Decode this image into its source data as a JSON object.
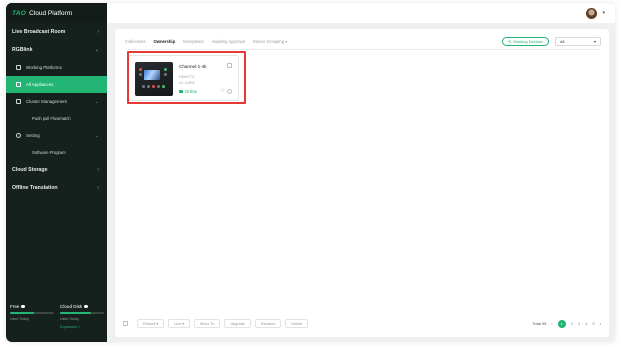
{
  "app": {
    "logo_mark": "TAO",
    "title": "Cloud Platform"
  },
  "sidebar": {
    "items": [
      {
        "label": "Live Broadcast Room"
      },
      {
        "label": "RGBlink"
      }
    ],
    "sub_items": [
      {
        "label": "Working Platforms"
      },
      {
        "label": "All Appliances"
      },
      {
        "label": "Cluster Management"
      },
      {
        "label": "Push pull Flowmatch"
      },
      {
        "label": "Setting"
      },
      {
        "label": "Software Program"
      }
    ],
    "bottom_items": [
      {
        "label": "Cloud Storage"
      },
      {
        "label": "Offline Translation"
      }
    ],
    "storage": {
      "left": {
        "title": "Free",
        "sub": "Used Today",
        "fill": 0.55
      },
      "right": {
        "title": "Cloud Disk",
        "sub": "Used Today",
        "fill": 0.7,
        "link": "Expansion >"
      }
    }
  },
  "header": {
    "avatar_caret": "▾"
  },
  "tabs": [
    "Collections",
    "Ownership",
    "Exceptions",
    "Awaiting Approval",
    "Device Grouping"
  ],
  "active_tab": "Ownership",
  "filter": {
    "button_label": "Working Devices",
    "select_value": "All"
  },
  "device": {
    "name": "Channel-1-4k",
    "line1": "HDMI TV",
    "line2": "V1.3.6R2",
    "status": "Online"
  },
  "footer": {
    "buttons": [
      "Reboot",
      "Live",
      "Move To",
      "Upgrade",
      "Rename",
      "Delete"
    ],
    "total": "Total 95",
    "pages": [
      "1",
      "2",
      "3",
      "4",
      "5"
    ]
  },
  "colors": {
    "accent": "#22b573",
    "sidebar_bg": "#16201c",
    "highlight": "#e53935"
  },
  "icons": [
    "grid-icon",
    "list-icon",
    "cluster-icon",
    "gear-icon",
    "star-icon",
    "more-icon",
    "chevron-right-icon",
    "chevron-left-icon"
  ]
}
